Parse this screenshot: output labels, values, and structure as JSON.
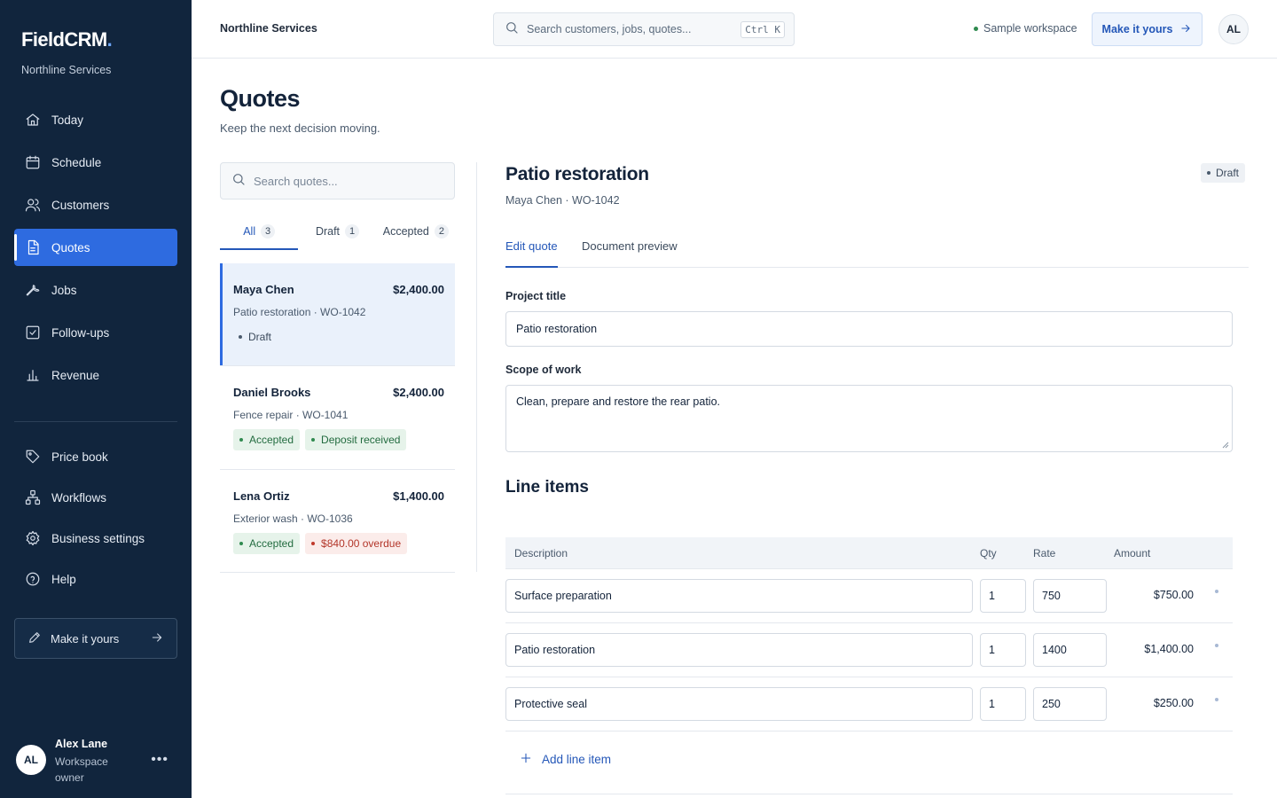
{
  "brand": {
    "name": "FieldCRM",
    "dot": ".",
    "org": "Northline Services"
  },
  "sidebar": {
    "nav": [
      {
        "label": "Today",
        "icon": "home-icon"
      },
      {
        "label": "Schedule",
        "icon": "calendar-icon"
      },
      {
        "label": "Customers",
        "icon": "users-icon"
      },
      {
        "label": "Quotes",
        "icon": "document-icon",
        "active": true
      },
      {
        "label": "Jobs",
        "icon": "wrench-icon"
      },
      {
        "label": "Follow-ups",
        "icon": "checkbox-icon"
      },
      {
        "label": "Revenue",
        "icon": "bar-chart-icon"
      }
    ],
    "secondary": [
      {
        "label": "Price book",
        "icon": "tag-icon"
      },
      {
        "label": "Workflows",
        "icon": "workflow-icon"
      },
      {
        "label": "Business settings",
        "icon": "gear-icon"
      },
      {
        "label": "Help",
        "icon": "help-circle-icon"
      }
    ],
    "make_it_yours": "Make it yours",
    "user": {
      "initials": "AL",
      "name": "Alex Lane",
      "role": "Workspace owner"
    }
  },
  "topbar": {
    "title": "Northline Services",
    "search_placeholder": "Search customers, jobs, quotes...",
    "shortcut": "Ctrl K",
    "workspace_label": "Sample workspace",
    "make_it_yours": "Make it yours",
    "avatar": "AL"
  },
  "page": {
    "title": "Quotes",
    "subtitle": "Keep the next decision moving."
  },
  "quote_list": {
    "search_placeholder": "Search quotes...",
    "filters": [
      {
        "label": "All",
        "count": "3",
        "active": true
      },
      {
        "label": "Draft",
        "count": "1"
      },
      {
        "label": "Accepted",
        "count": "2"
      }
    ],
    "quotes": [
      {
        "customer": "Maya Chen",
        "amount": "$2,400.00",
        "subtitle": "Patio restoration · WO-1042",
        "tags": [
          {
            "text": "Draft",
            "tone": "plain"
          }
        ]
      },
      {
        "customer": "Daniel Brooks",
        "amount": "$2,400.00",
        "subtitle": "Fence repair · WO-1041",
        "tags": [
          {
            "text": "Accepted",
            "tone": "green"
          },
          {
            "text": "Deposit received",
            "tone": "green"
          }
        ]
      },
      {
        "customer": "Lena Ortiz",
        "amount": "$1,400.00",
        "subtitle": "Exterior wash · WO-1036",
        "tags": [
          {
            "text": "Accepted",
            "tone": "green"
          },
          {
            "text": "$840.00 overdue",
            "tone": "red"
          }
        ]
      }
    ]
  },
  "detail": {
    "title": "Patio restoration",
    "subtitle": "Maya Chen · WO-1042",
    "status": "Draft",
    "tabs": [
      {
        "label": "Edit quote",
        "active": true
      },
      {
        "label": "Document preview"
      }
    ],
    "project_title_label": "Project title",
    "project_title_value": "Patio restoration",
    "scope_label": "Scope of work",
    "scope_value": "Clean, prepare and restore the rear patio.",
    "line_items_title": "Line items",
    "columns": {
      "description": "Description",
      "qty": "Qty",
      "rate": "Rate",
      "amount": "Amount"
    },
    "line_items": [
      {
        "description": "Surface preparation",
        "qty": "1",
        "rate": "750",
        "amount": "$750.00"
      },
      {
        "description": "Patio restoration",
        "qty": "1",
        "rate": "1400",
        "amount": "$1,400.00"
      },
      {
        "description": "Protective seal",
        "qty": "1",
        "rate": "250",
        "amount": "$250.00"
      }
    ],
    "add_line_label": "Add line item"
  }
}
